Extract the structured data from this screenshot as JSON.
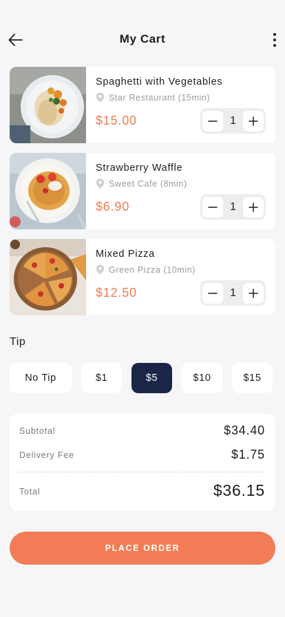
{
  "header": {
    "title": "My Cart",
    "back_icon": "arrow-left-icon",
    "menu_icon": "more-vertical-icon"
  },
  "cart_items": [
    {
      "name": "Spaghetti with Vegetables",
      "location": "Star Restaurant (15min)",
      "price": "$15.00",
      "quantity": "1"
    },
    {
      "name": "Strawberry Waffle",
      "location": "Sweet Cafe (8min)",
      "price": "$6.90",
      "quantity": "1"
    },
    {
      "name": "Mixed Pizza",
      "location": "Green Pizza (10min)",
      "price": "$12.50",
      "quantity": "1"
    }
  ],
  "tip": {
    "title": "Tip",
    "options": [
      "No Tip",
      "$1",
      "$5",
      "$10",
      "$15"
    ],
    "selected": "$5"
  },
  "summary": {
    "subtotal_label": "Subtotal",
    "subtotal_value": "$34.40",
    "delivery_label": "Delivery Fee",
    "delivery_value": "$1.75",
    "total_label": "Total",
    "total_value": "$36.15"
  },
  "cta": {
    "label": "PLACE ORDER"
  },
  "colors": {
    "accent": "#f27c55",
    "price": "#f27a52",
    "selected_tip": "#1b2547",
    "background": "#f6f6f8"
  }
}
